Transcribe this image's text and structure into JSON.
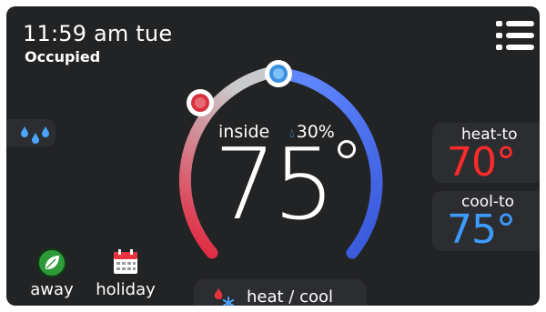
{
  "status": {
    "time": "11:59 am tue",
    "occupancy": "Occupied"
  },
  "dial": {
    "inside_label": "inside",
    "humidity": "30%",
    "current_temp": "75",
    "heat_handle_color": "#d8323f",
    "cool_handle_color": "#3a8fe0"
  },
  "setpoints": {
    "heat_label": "heat-to",
    "heat_value": "70°",
    "heat_color": "#ff2a2a",
    "cool_label": "cool-to",
    "cool_value": "75°",
    "cool_color": "#3d9bff"
  },
  "bottom": {
    "away_label": "away",
    "holiday_label": "holiday",
    "mode_label": "heat / cool"
  },
  "icons": {
    "menu": "menu-icon",
    "humidity": "water-drops-icon",
    "away": "leaf-icon",
    "holiday": "calendar-icon",
    "mode": "flame-snowflake-icon"
  }
}
